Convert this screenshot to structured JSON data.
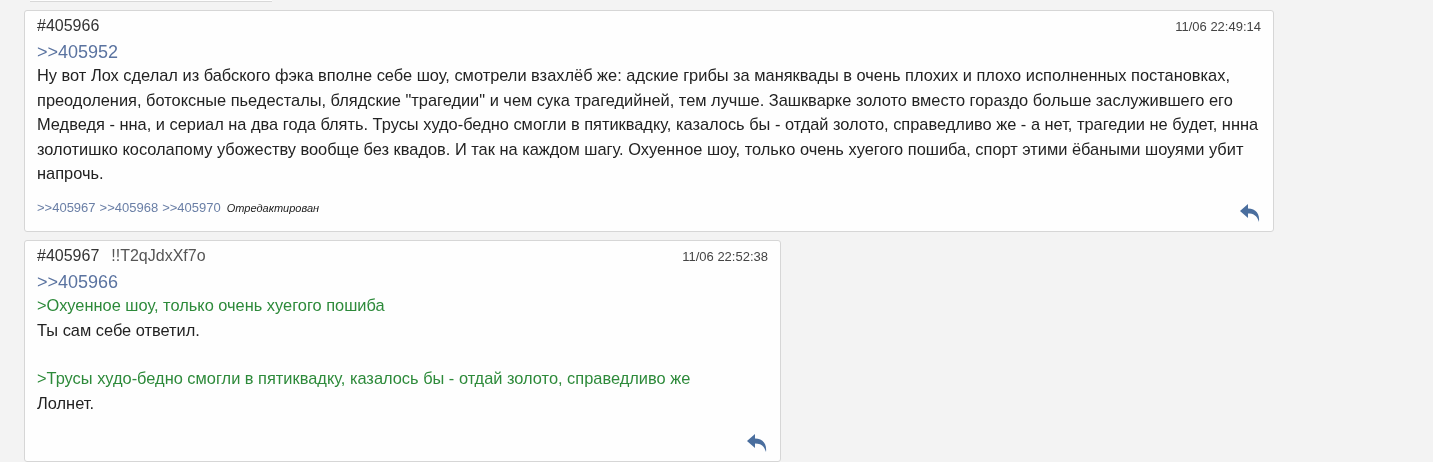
{
  "posts": [
    {
      "number": "#405966",
      "date": "11/06 22:49:14",
      "reply_to": ">>405952",
      "paragraphs": [
        [
          {
            "kind": "text",
            "text": "Ну вот Лох сделал из бабского фэка вполне себе шоу, смотрели взахлёб же: адские грибы за маняквады в очень плохих и плохо исполненных постановках, преодоления, ботоксные пьедесталы, блядские \"трагедии\" и чем сука трагедийней, тем лучше. Зашкварке золото вместо гораздо больше заслужившего его Медведя - нна, и сериал на два года блять. Трусы худо-бедно смогли в пятиквадку, казалось бы - отдай золото, справедливо же - а нет, трагедии не будет, ннна золотишко косолапому убожеству вообще без квадов. И так на каждом шагу. Охуенное шоу, только очень хуегого пошиба, спорт этими ёбаными шоуями убит напрочь."
          }
        ]
      ],
      "replies": [
        ">>405967",
        ">>405968",
        ">>405970"
      ],
      "edited": "Отредактирован"
    },
    {
      "number": "#405967",
      "trip": "!!T2qJdxXf7o",
      "date": "11/06 22:52:38",
      "reply_to": ">>405966",
      "paragraphs": [
        [
          {
            "kind": "quote",
            "text": ">Охуенное шоу, только очень хуегого пошиба"
          },
          {
            "kind": "text",
            "text": "Ты сам себе ответил."
          }
        ],
        [
          {
            "kind": "quote",
            "text": ">Трусы худо-бедно смогли в пятиквадку, казалось бы - отдай золото, справедливо же"
          },
          {
            "kind": "text",
            "text": "Лолнет."
          }
        ]
      ]
    }
  ]
}
